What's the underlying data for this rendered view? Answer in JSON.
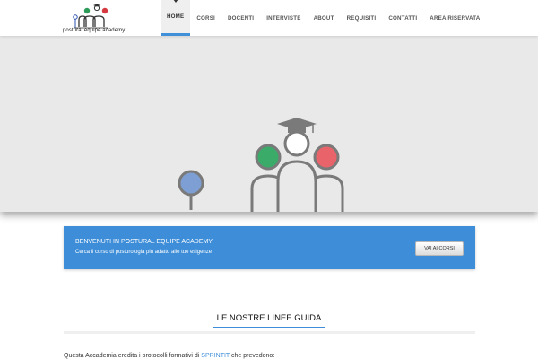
{
  "logo": {
    "text": "postural equipe academy"
  },
  "nav": {
    "items": [
      {
        "label": "HOME",
        "active": true
      },
      {
        "label": "CORSI"
      },
      {
        "label": "DOCENTI"
      },
      {
        "label": "INTERVISTE"
      },
      {
        "label": "ABOUT"
      },
      {
        "label": "REQUISITI"
      },
      {
        "label": "CONTATTI"
      },
      {
        "label": "AREA RISERVATA"
      }
    ]
  },
  "banner": {
    "title": "BENVENUTI IN POSTURAL EQUIPE ACADEMY",
    "subtitle": "Cerca il corso di posturologia più adatto alle tue esigenze",
    "button_label": "VAI AI CORSI"
  },
  "section": {
    "title": "LE NOSTRE LINEE GUIDA",
    "intro_prefix": "Questa Accademia eredita i protocolli formativi di ",
    "intro_link": "SPRINTIT",
    "intro_suffix": " che prevedono:"
  },
  "colors": {
    "accent": "#3d8dd8",
    "hero_bg": "#e9e9e9",
    "green": "#3bab6a",
    "red": "#e8646a",
    "blue_lens": "#7e9fd3",
    "figure_gray": "#7a7a7a"
  }
}
